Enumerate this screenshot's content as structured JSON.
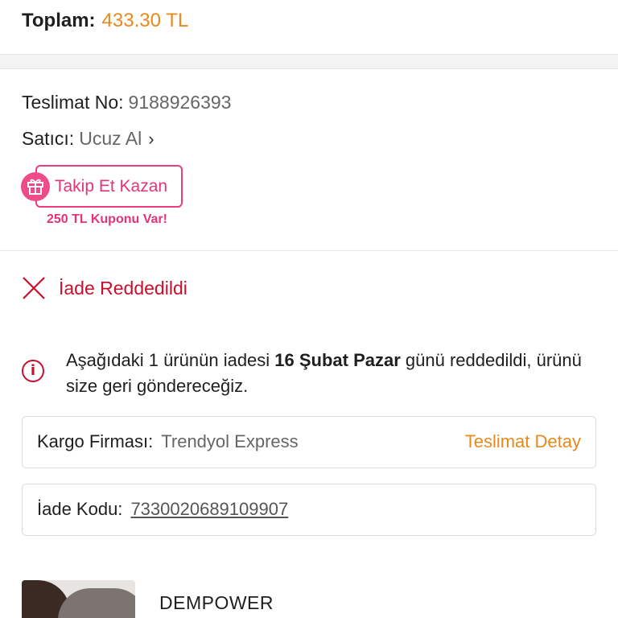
{
  "order": {
    "total_label": "Toplam:",
    "total_value": "433.30 TL"
  },
  "delivery": {
    "number_label": "Teslimat No:",
    "number_value": "9188926393",
    "seller_label": "Satıcı:",
    "seller_value": "Ucuz Al",
    "follow_button_label": "Takip Et Kazan",
    "coupon_text": "250 TL Kuponu Var!"
  },
  "return_status": {
    "title": "İade Reddedildi",
    "message_part1": "Aşağıdaki 1 ürünün iadesi ",
    "message_bold": "16 Şubat Pazar",
    "message_part2": " günü reddedildi, ürünü size geri göndereceğiz.",
    "cargo_label": "Kargo Firması:",
    "cargo_value": "Trendyol Express",
    "detail_link": "Teslimat Detay",
    "return_code_label": "İade Kodu:",
    "return_code_value": "7330020689109907"
  },
  "product": {
    "brand": "DEMPOWER"
  },
  "colors": {
    "accent_orange": "#e8891c",
    "pink": "#e23476",
    "error_red": "#c8102e"
  }
}
